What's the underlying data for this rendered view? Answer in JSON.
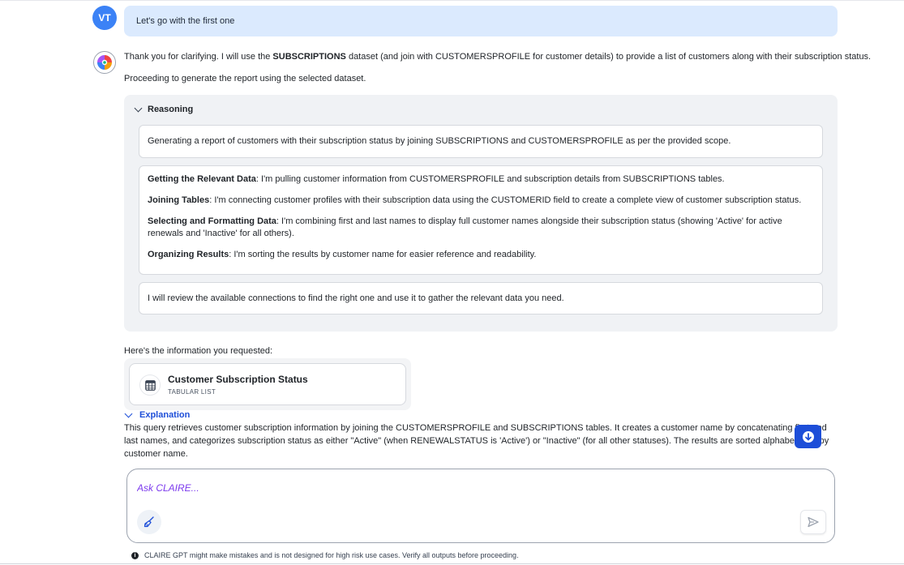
{
  "user_message": {
    "avatar_initials": "VT",
    "text": "Let's go with the first one"
  },
  "bot_message": {
    "line1_pre": "Thank you for clarifying. I will use the ",
    "line1_bold": "SUBSCRIPTIONS",
    "line1_post": " dataset (and join with CUSTOMERSPROFILE for customer details) to provide a list of customers along with their subscription status.",
    "line2": "Proceeding to generate the report using the selected dataset."
  },
  "reasoning": {
    "title": "Reasoning",
    "summary": "Generating a report of customers with their subscription status by joining SUBSCRIPTIONS and CUSTOMERSPROFILE as per the provided scope.",
    "steps": [
      {
        "label": "Getting the Relevant Data",
        "text": ": I'm pulling customer information from CUSTOMERSPROFILE and subscription details from SUBSCRIPTIONS tables."
      },
      {
        "label": "Joining Tables",
        "text": ": I'm connecting customer profiles with their subscription data using the CUSTOMERID field to create a complete view of customer subscription status."
      },
      {
        "label": "Selecting and Formatting Data",
        "text": ": I'm combining first and last names to display full customer names alongside their subscription status (showing 'Active' for active renewals and 'Inactive' for all others)."
      },
      {
        "label": "Organizing Results",
        "text": ": I'm sorting the results by customer name for easier reference and readability."
      }
    ],
    "final": "I will review the available connections to find the right one and use it to gather the relevant data you need."
  },
  "result": {
    "intro": "Here's the information you requested:",
    "artifact_title": "Customer Subscription Status",
    "artifact_type": "TABULAR LIST",
    "icon": "table-icon"
  },
  "explanation": {
    "toggle_label": "Explanation",
    "text": "This query retrieves customer subscription information by joining the CUSTOMERSPROFILE and SUBSCRIPTIONS tables. It creates a customer name by concatenating first and last names, and categorizes subscription status as either \"Active\" (when RENEWALSTATUS is 'Active') or \"Inactive\" (for all other statuses). The results are sorted alphabetically by customer name."
  },
  "composer": {
    "placeholder": "Ask CLAIRE...",
    "clean_icon": "broom-icon",
    "send_icon": "send-icon"
  },
  "disclaimer": "CLAIRE GPT might make mistakes and is not designed for high risk use cases. Verify all outputs before proceeding.",
  "colors": {
    "accent": "#1d4ed8",
    "user_bubble": "#dbeafe",
    "avatar": "#3b82f6",
    "reasoning_bg": "#f0f2f5"
  }
}
